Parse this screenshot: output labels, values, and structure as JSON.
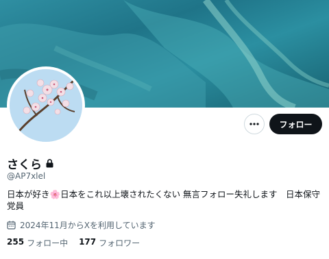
{
  "profile": {
    "name": "さくら",
    "handle": "@AP7xlel",
    "bio": "日本が好き🌸日本をこれ以上壊されたくない 無言フォロー失礼します　日本保守党員",
    "joined": "2024年11月からXを利用しています"
  },
  "actions": {
    "follow_label": "フォロー",
    "more_label": "•••"
  },
  "stats": {
    "following_count": "255",
    "following_label": "フォロー中",
    "followers_count": "177",
    "followers_label": "フォロワー"
  },
  "icons": {
    "lock": "lock-icon",
    "calendar": "calendar-icon",
    "more": "more-icon"
  },
  "colors": {
    "accent": "#0f1419",
    "secondary_text": "#536471",
    "border": "#cfd9de"
  }
}
